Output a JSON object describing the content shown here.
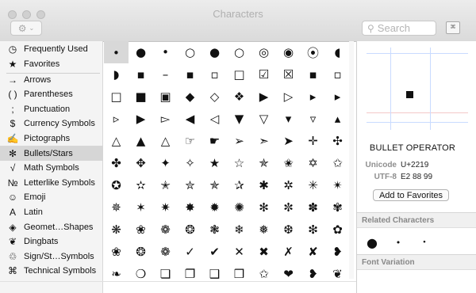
{
  "window": {
    "title": "Characters"
  },
  "toolbar": {
    "action_icon": "gear-icon",
    "search_placeholder": "Search",
    "keyboard_label": "⌘"
  },
  "sidebar": {
    "top_items": [
      {
        "label": "Frequently Used",
        "icon": "◷"
      },
      {
        "label": "Favorites",
        "icon": "★"
      }
    ],
    "items": [
      {
        "label": "Arrows",
        "icon": "→"
      },
      {
        "label": "Parentheses",
        "icon": "( )"
      },
      {
        "label": "Punctuation",
        "icon": ";"
      },
      {
        "label": "Currency Symbols",
        "icon": "$"
      },
      {
        "label": "Pictographs",
        "icon": "✍"
      },
      {
        "label": "Bullets/Stars",
        "icon": "✻"
      },
      {
        "label": "Math Symbols",
        "icon": "√"
      },
      {
        "label": "Letterlike Symbols",
        "icon": "№"
      },
      {
        "label": "Emoji",
        "icon": "☺"
      },
      {
        "label": "Latin",
        "icon": "A"
      },
      {
        "label": "Geomet…Shapes",
        "icon": "◈"
      },
      {
        "label": "Dingbats",
        "icon": "❦"
      },
      {
        "label": "Sign/St…Symbols",
        "icon": "♲"
      },
      {
        "label": "Technical Symbols",
        "icon": "⌘"
      }
    ],
    "selected": "Bullets/Stars"
  },
  "grid": {
    "rows": [
      [
        "∙",
        "●",
        "•",
        "○",
        "●",
        "○",
        "◎",
        "◉",
        "⦿",
        "◖"
      ],
      [
        "◗",
        "▪",
        "–",
        "▪",
        "▫",
        "□",
        "☑",
        "☒",
        "▪",
        "▫"
      ],
      [
        "□",
        "■",
        "▣",
        "◆",
        "◇",
        "❖",
        "▶",
        "▷",
        "▸",
        "▸"
      ],
      [
        "▹",
        "▶",
        "▻",
        "◀",
        "◁",
        "▼",
        "▽",
        "▾",
        "▿",
        "▴"
      ],
      [
        "△",
        "▲",
        "△",
        "☞",
        "☛",
        "➢",
        "➣",
        "➤",
        "✛",
        "✣"
      ],
      [
        "✤",
        "✥",
        "✦",
        "✧",
        "★",
        "☆",
        "✯",
        "✬",
        "✡",
        "✩"
      ],
      [
        "✪",
        "✫",
        "✭",
        "✮",
        "✯",
        "✰",
        "✱",
        "✲",
        "✳",
        "✴"
      ],
      [
        "✵",
        "✶",
        "✷",
        "✸",
        "✹",
        "✺",
        "✻",
        "✼",
        "✽",
        "✾"
      ],
      [
        "❋",
        "❀",
        "❁",
        "❂",
        "❃",
        "❄",
        "❅",
        "❆",
        "❇",
        "✿"
      ],
      [
        "❀",
        "❂",
        "❁",
        "✓",
        "✔",
        "✕",
        "✖",
        "✗",
        "✘",
        "❥"
      ],
      [
        "❧",
        "❍",
        "❏",
        "❐",
        "❑",
        "❒",
        "✩",
        "❤",
        "❥",
        "❦"
      ]
    ],
    "selected": "∙"
  },
  "detail": {
    "name": "BULLET OPERATOR",
    "unicode_label": "Unicode",
    "unicode_value": "U+2219",
    "utf8_label": "UTF-8",
    "utf8_value": "E2 88 99",
    "favorites_button": "Add to Favorites",
    "related_heading": "Related Characters",
    "related": [
      "●",
      "•",
      "∙"
    ],
    "font_variation_heading": "Font Variation"
  }
}
